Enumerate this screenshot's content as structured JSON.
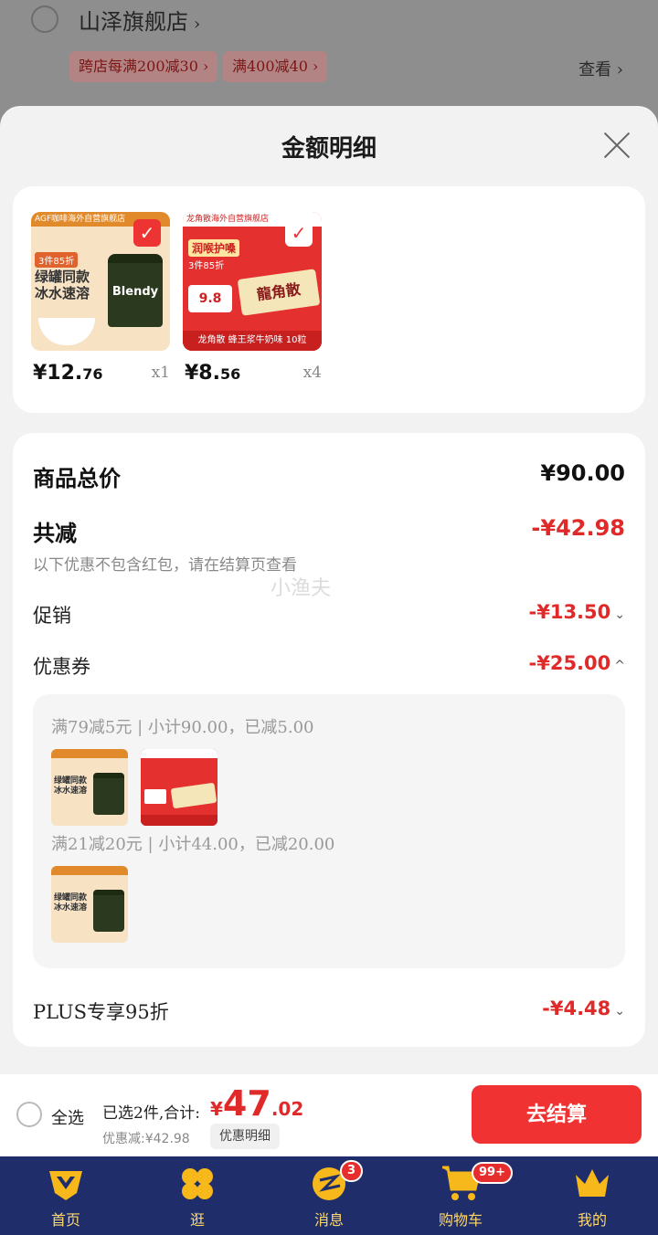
{
  "background": {
    "store_name": "山泽旗舰店",
    "store_chevron": "›",
    "promo_tags": [
      "跨店每满200减30 ›",
      "满400减40 ›"
    ],
    "view_link": "查看 ›"
  },
  "sheet": {
    "title": "金额明细",
    "products": [
      {
        "price_int": "¥12.",
        "price_dec": "76",
        "qty": "x1",
        "thumb_text": {
          "brand": "AGF咖啡海外自营旗舰店",
          "deal": "3件85折",
          "headline_1": "绿罐同款",
          "headline_2": "冰水速溶",
          "jar": "Blendy"
        }
      },
      {
        "price_int": "¥8.",
        "price_dec": "56",
        "qty": "x4",
        "thumb_text": {
          "brand": "龙角散海外自营旗舰店",
          "tag": "润喉护嗓",
          "deal": "3件85折",
          "price": "9.8",
          "box": "龍角散",
          "strip": "龙角散 蜂王浆牛奶味 10粒"
        }
      }
    ],
    "summary": {
      "goods_total_label": "商品总价",
      "goods_total_value": "¥90.00",
      "total_reduce_label": "共减",
      "total_reduce_value": "-¥42.98",
      "note": "以下优惠不包含红包，请在结算页查看",
      "watermark": "小渔夫",
      "promo_label": "促销",
      "promo_value": "-¥13.50",
      "coupon_label": "优惠券",
      "coupon_value": "-¥25.00",
      "coupon_rules": [
        "满79减5元 | 小计90.00，已减5.00",
        "满21减20元 | 小计44.00，已减20.00"
      ],
      "plus_label": "PLUS专享95折",
      "plus_value": "-¥4.48",
      "arrow_down": "⌄",
      "arrow_up": "^"
    }
  },
  "checkout": {
    "select_all": "全选",
    "selected": "已选2件,合计:",
    "total_yen": "¥",
    "total_big": "47",
    "total_dec": ".02",
    "discount": "优惠减:¥42.98",
    "detail_button": "优惠明细",
    "go_button": "去结算"
  },
  "tabbar": {
    "items": [
      {
        "label": "首页",
        "icon": "home-icon"
      },
      {
        "label": "逛",
        "icon": "explore-icon"
      },
      {
        "label": "消息",
        "icon": "message-icon",
        "badge": "3"
      },
      {
        "label": "购物车",
        "icon": "cart-icon",
        "badge": "99+"
      },
      {
        "label": "我的",
        "icon": "crown-icon"
      }
    ]
  },
  "colors": {
    "accent_red": "#e02a2a",
    "button_red": "#f03232",
    "tabbar_bg": "#1f2e6b",
    "tab_label": "#ffd86a"
  }
}
